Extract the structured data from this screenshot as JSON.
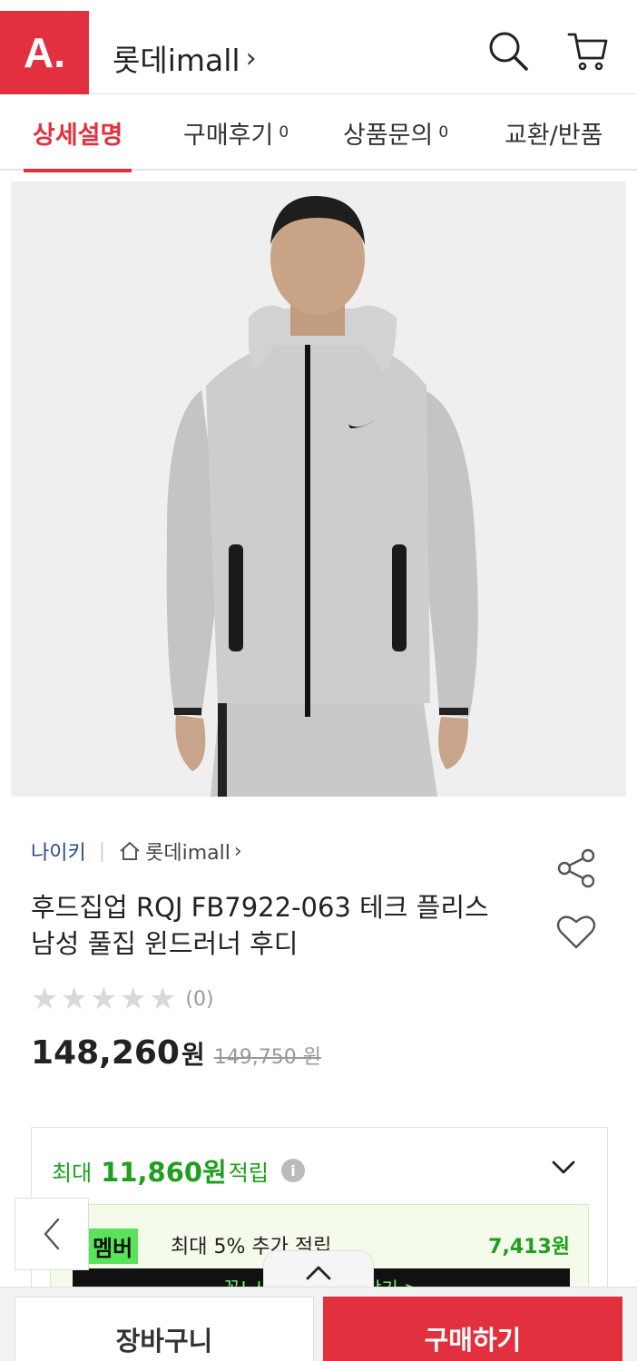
{
  "header": {
    "logo_text": "A.",
    "mall_name": "롯데imall",
    "chevron": "›",
    "icons": [
      "search-icon",
      "cart-icon"
    ],
    "accent_color": "#e3303e"
  },
  "tabs": [
    {
      "label": "상세설명",
      "count": "",
      "active": true
    },
    {
      "label": "구매후기",
      "count": "0",
      "active": false
    },
    {
      "label": "상품문의",
      "count": "0",
      "active": false
    },
    {
      "label": "교환/반품",
      "count": "",
      "active": false
    }
  ],
  "product": {
    "brand": "나이키",
    "store": "롯데imall",
    "title": "후드집업 RQJ FB7922-063 테크 플리스 남성 풀집 윈드러너 후디",
    "rating_count": "(0)",
    "stars_filled": 0,
    "stars_total": 5,
    "price": "148,260",
    "price_unit": "원",
    "original_price": "149,750 원"
  },
  "reward": {
    "prefix": "최대",
    "amount": "11,860원",
    "suffix": "적립",
    "info_glyph": "i",
    "member_badge": "멤버",
    "member_text": "최대 5% 추가 적립",
    "member_amount": "7,413원",
    "cta_text": "꼭! 시작하고 혜택 받기 >",
    "green_color": "#1ea01e"
  },
  "bottom": {
    "cart_label": "장바구니",
    "buy_label": "구매하기"
  }
}
